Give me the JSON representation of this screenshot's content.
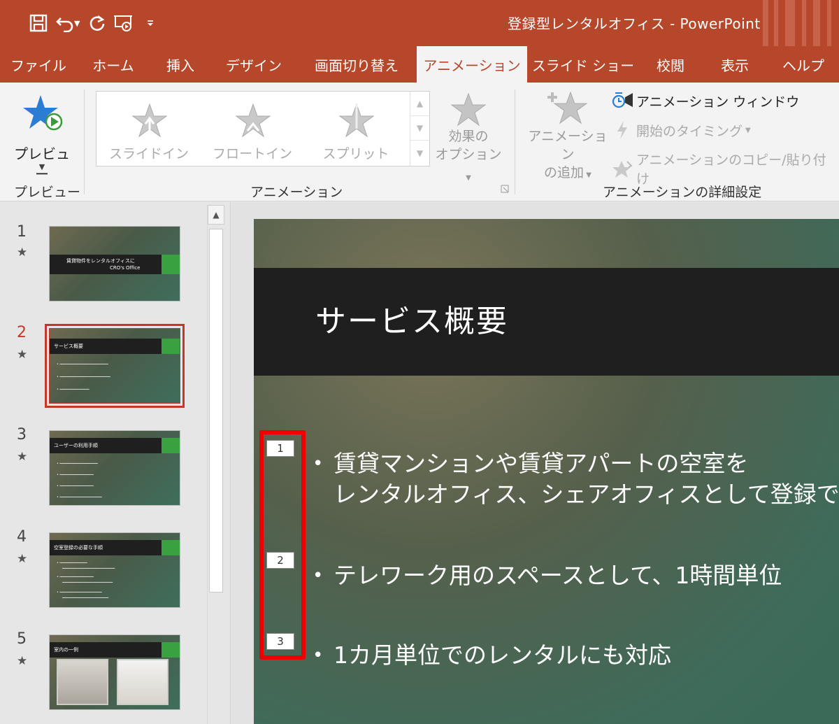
{
  "window": {
    "title": "登録型レンタルオフィス - PowerPoint",
    "brand_color": "#b7472a"
  },
  "qat": {
    "save_icon": "save-icon",
    "undo_icon": "undo-icon",
    "redo_icon": "redo-icon",
    "present_icon": "present-from-start-icon",
    "customize_icon": "customize-qat-icon"
  },
  "tabs": [
    {
      "label": "ファイル"
    },
    {
      "label": "ホーム"
    },
    {
      "label": "挿入"
    },
    {
      "label": "デザイン"
    },
    {
      "label": "画面切り替え"
    },
    {
      "label": "アニメーション",
      "active": true
    },
    {
      "label": "スライド ショー"
    },
    {
      "label": "校閲"
    },
    {
      "label": "表示"
    },
    {
      "label": "ヘルプ"
    }
  ],
  "ribbon": {
    "preview": {
      "button_label": "プレビュー",
      "group_label": "プレビュー"
    },
    "animation": {
      "items": [
        {
          "label": "スライドイン"
        },
        {
          "label": "フロートイン"
        },
        {
          "label": "スプリット"
        }
      ],
      "effect_options_line1": "効果の",
      "effect_options_line2": "オプション",
      "group_label": "アニメーション"
    },
    "advanced": {
      "add_animation_line1": "アニメーション",
      "add_animation_line2": "の追加",
      "animation_pane": "アニメーション ウィンドウ",
      "trigger": "開始のタイミング",
      "painter": "アニメーションのコピー/貼り付け",
      "group_label": "アニメーションの詳細設定"
    }
  },
  "thumbnails": [
    {
      "number": "1",
      "title": "賃貸物件をレンタルオフィスに",
      "subtitle": "CRO's Office"
    },
    {
      "number": "2",
      "title": "サービス概要",
      "active": true
    },
    {
      "number": "3",
      "title": "ユーザーの利用手順"
    },
    {
      "number": "4",
      "title": "空室登録の必要な手順"
    },
    {
      "number": "5",
      "title": "室内の一例"
    }
  ],
  "slide": {
    "title": "サービス概要",
    "bullets": [
      {
        "tag": "1",
        "line1": "賃貸マンションや賃貸アパートの空室を",
        "line2": "レンタルオフィス、シェアオフィスとして登録で"
      },
      {
        "tag": "2",
        "line1": "テレワーク用のスペースとして、1時間単位"
      },
      {
        "tag": "3",
        "line1": "1カ月単位でのレンタルにも対応"
      }
    ],
    "bullet_char": "•",
    "highlight_color": "#ee0000"
  }
}
